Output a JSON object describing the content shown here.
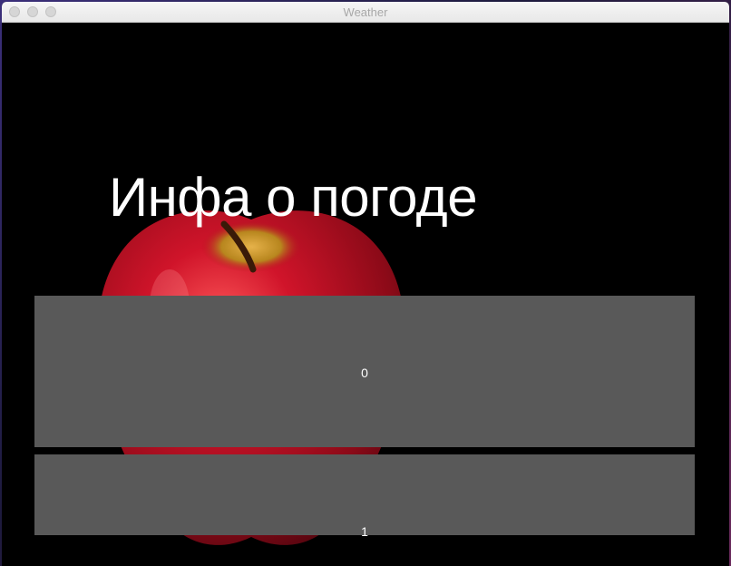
{
  "window": {
    "title": "Weather"
  },
  "main": {
    "heading": "Инфа о погоде",
    "items": [
      {
        "label": "0"
      },
      {
        "label": "1"
      }
    ]
  },
  "colors": {
    "window_bg": "#000000",
    "row_bg": "#595959",
    "heading_text": "#ffffff",
    "apple_red": "#c8102e"
  },
  "icons": {
    "background_image": "red-apple-image"
  }
}
